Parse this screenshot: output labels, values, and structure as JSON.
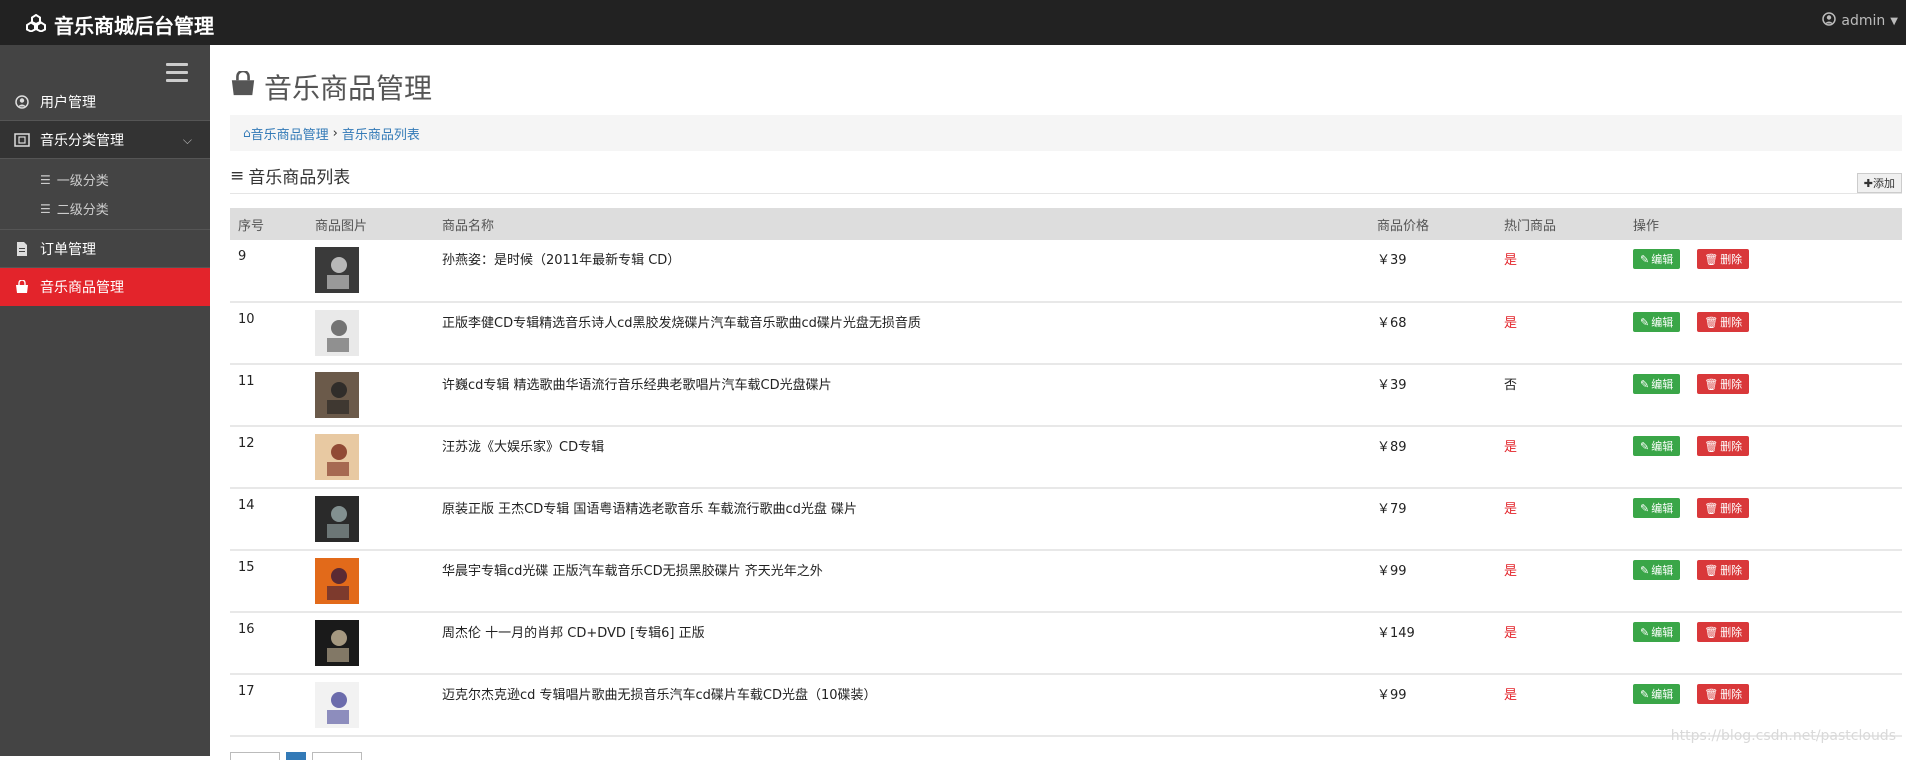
{
  "app": {
    "title": "音乐商城后台管理",
    "logo_icon": "cubes-icon",
    "user": "admin"
  },
  "sidebar": {
    "items": [
      {
        "label": "用户管理",
        "icon": "user-circle-icon"
      },
      {
        "label": "音乐分类管理",
        "icon": "category-icon",
        "expanded": true
      },
      {
        "label": "订单管理",
        "icon": "file-icon"
      },
      {
        "label": "音乐商品管理",
        "icon": "shopping-bag-icon",
        "active": true
      }
    ],
    "sub_items": [
      {
        "label": "一级分类"
      },
      {
        "label": "二级分类"
      }
    ]
  },
  "page": {
    "title": "音乐商品管理",
    "section_title": "音乐商品列表",
    "add_label": "添加"
  },
  "breadcrumb": {
    "home": "音乐商品管理",
    "separator": "›",
    "current": "音乐商品列表"
  },
  "table": {
    "headers": [
      "序号",
      "商品图片",
      "商品名称",
      "商品价格",
      "热门商品",
      "操作"
    ],
    "edit_label": "编辑",
    "delete_label": "删除",
    "rows": [
      {
        "id": "9",
        "name": "孙燕姿：是时候（2011年最新专辑 CD）",
        "price": "￥39",
        "hot": "是"
      },
      {
        "id": "10",
        "name": "正版李健CD专辑精选音乐诗人cd黑胶发烧碟片汽车载音乐歌曲cd碟片光盘无损音质",
        "price": "￥68",
        "hot": "是"
      },
      {
        "id": "11",
        "name": "许巍cd专辑 精选歌曲华语流行音乐经典老歌唱片汽车载CD光盘碟片",
        "price": "￥39",
        "hot": "否"
      },
      {
        "id": "12",
        "name": "汪苏泷《大娱乐家》CD专辑",
        "price": "￥89",
        "hot": "是"
      },
      {
        "id": "14",
        "name": "原装正版 王杰CD专辑 国语粤语精选老歌音乐 车载流行歌曲cd光盘 碟片",
        "price": "￥79",
        "hot": "是"
      },
      {
        "id": "15",
        "name": "华晨宇专辑cd光碟 正版汽车载音乐CD无损黑胶碟片 齐天光年之外",
        "price": "￥99",
        "hot": "是"
      },
      {
        "id": "16",
        "name": "周杰伦 十一月的肖邦 CD+DVD [专辑6] 正版",
        "price": "￥149",
        "hot": "是"
      },
      {
        "id": "17",
        "name": "迈克尔杰克逊cd 专辑唱片歌曲无损音乐汽车cd碟片车载CD光盘（10碟装）",
        "price": "￥99",
        "hot": "是"
      }
    ]
  },
  "watermark": "https://blog.csdn.net/pastclouds",
  "colors": {
    "active": "#e3242b",
    "edit": "#3aa648",
    "delete": "#d9383a",
    "link": "#337ab7"
  }
}
